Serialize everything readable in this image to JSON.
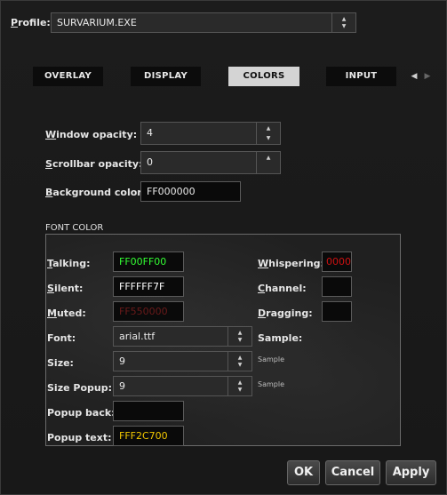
{
  "profile": {
    "label": "Profile:",
    "accel": "P",
    "rest": "rofile:",
    "value": "SURVARIUM.EXE"
  },
  "tabs": [
    "OVERLAY",
    "DISPLAY",
    "COLORS",
    "INPUT"
  ],
  "active_tab": "COLORS",
  "opacity": {
    "window": {
      "accel": "W",
      "rest": "indow opacity:",
      "value": "4"
    },
    "scrollbar": {
      "accel": "S",
      "rest": "crollbar opacity:",
      "value": "0"
    },
    "background": {
      "accel": "B",
      "rest": "ackground color:",
      "value": "FF000000"
    }
  },
  "font_color": {
    "title": "FONT COLOR",
    "talking": {
      "accel": "T",
      "rest": "alking:",
      "value": "FF00FF00",
      "color": "#33ff33"
    },
    "silent": {
      "accel": "S",
      "rest": "ilent:",
      "value": "FFFFFF7F",
      "color": "#ffffff"
    },
    "muted": {
      "accel": "M",
      "rest": "uted:",
      "value": "FF550000",
      "color": "#6a1a1a"
    },
    "whispering": {
      "accel": "W",
      "rest": "hispering:",
      "value": "0000",
      "color": "#cc1111"
    },
    "channel": {
      "accel": "C",
      "rest": "hannel:"
    },
    "dragging": {
      "accel": "D",
      "rest": "ragging:"
    },
    "font": {
      "label": "Font:",
      "value": "arial.ttf"
    },
    "sample_label": "Sample:",
    "size": {
      "label": "Size:",
      "value": "9",
      "sample": "Sample"
    },
    "size_popup": {
      "label": "Size Popup:",
      "value": "9",
      "sample": "Sample"
    },
    "popup_back": {
      "label": "Popup back:",
      "value": ""
    },
    "popup_text": {
      "label": "Popup text:",
      "value": "FFF2C700",
      "color": "#f2c700"
    }
  },
  "buttons": {
    "ok": "OK",
    "cancel": "Cancel",
    "apply": "Apply"
  },
  "icons": {
    "spin_up": "up-arrow-icon",
    "spin_down": "down-arrow-icon",
    "tab_prev": "left-arrow-icon",
    "tab_next": "right-arrow-icon"
  }
}
